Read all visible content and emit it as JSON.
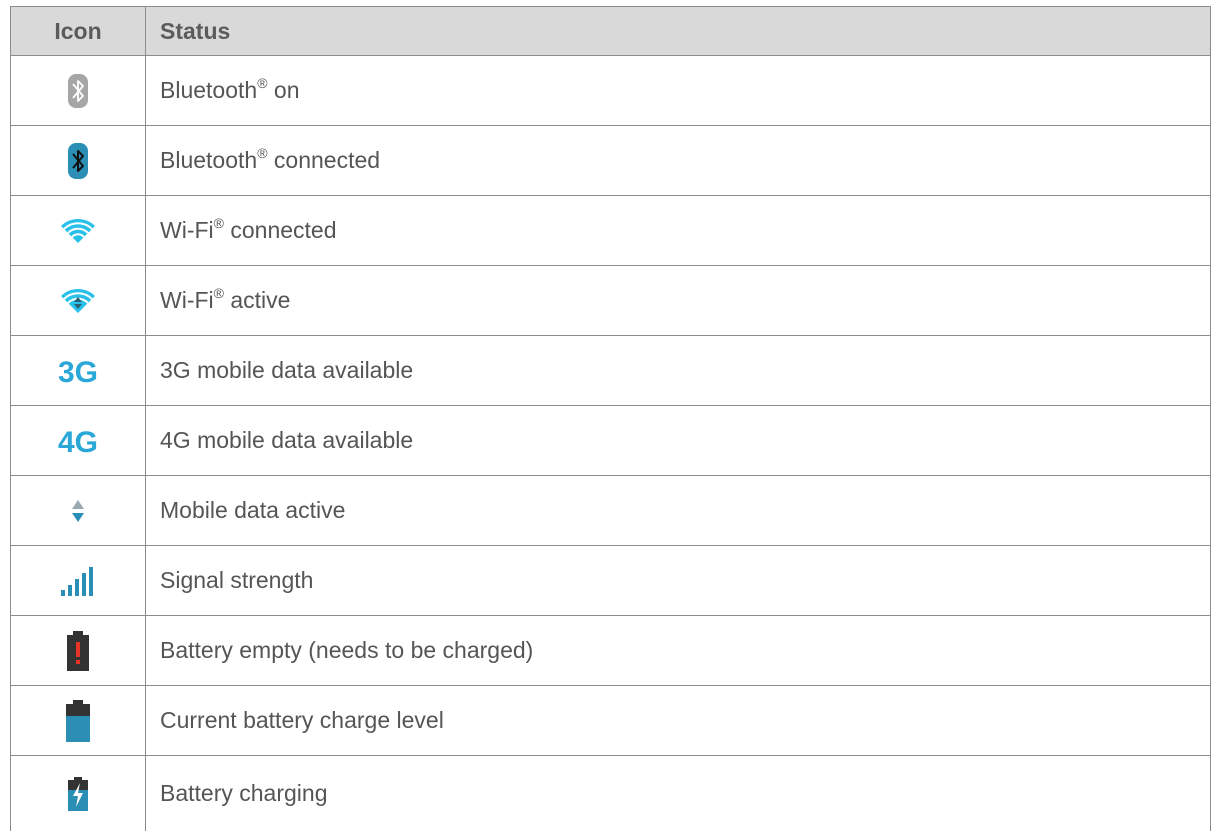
{
  "table": {
    "header": {
      "icon": "Icon",
      "status": "Status"
    },
    "rows": [
      {
        "icon": "bluetooth-on-icon",
        "status": {
          "pre": "Bluetooth",
          "sup": "®",
          "post": " on"
        }
      },
      {
        "icon": "bluetooth-connected-icon",
        "status": {
          "pre": "Bluetooth",
          "sup": "®",
          "post": " connected"
        }
      },
      {
        "icon": "wifi-connected-icon",
        "status": {
          "pre": "Wi-Fi",
          "sup": "®",
          "post": " connected"
        }
      },
      {
        "icon": "wifi-active-icon",
        "status": {
          "pre": "Wi-Fi",
          "sup": "®",
          "post": " active"
        }
      },
      {
        "icon": "3g-icon",
        "icon_text": "3G",
        "status": {
          "pre": "3G mobile data available"
        }
      },
      {
        "icon": "4g-icon",
        "icon_text": "4G",
        "status": {
          "pre": "4G mobile data available"
        }
      },
      {
        "icon": "mobile-data-active-icon",
        "status": {
          "pre": "Mobile data active"
        }
      },
      {
        "icon": "signal-strength-icon",
        "status": {
          "pre": "Signal strength"
        }
      },
      {
        "icon": "battery-empty-icon",
        "status": {
          "pre": "Battery empty (needs to be charged)"
        }
      },
      {
        "icon": "battery-level-icon",
        "status": {
          "pre": "Current battery charge level"
        }
      },
      {
        "icon": "battery-charging-icon",
        "status": {
          "pre": "Battery charging"
        }
      }
    ]
  },
  "colors": {
    "header_bg": "#d9d9d9",
    "border": "#8c8c8c",
    "text": "#555555",
    "icon_blue": "#29c1ea",
    "icon_teal": "#2b8fb5",
    "icon_gray": "#a6a6a6",
    "battery_dark": "#333333",
    "battery_red": "#e53325"
  }
}
